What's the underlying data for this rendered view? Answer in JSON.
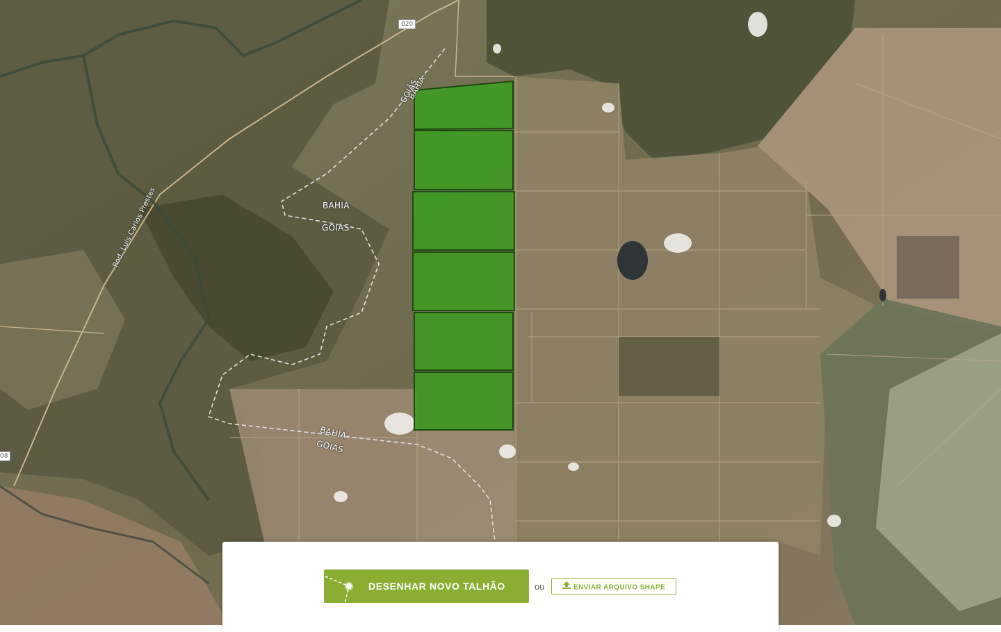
{
  "map": {
    "labels": {
      "bahia_top": "BAHIA",
      "goias_top": "GOIÁS",
      "bahia_mid": "BAHIA",
      "goias_mid": "GOIÁS",
      "bahia_bottom": "BAHIA",
      "goias_bottom": "GOIÁS",
      "road_name": "Rod. Luís Carlos Prestes"
    },
    "road_shields": {
      "top": "020",
      "left": "08"
    },
    "field_color": "#3f9a22",
    "field_border_color": "#1c4a10",
    "field_count": 6
  },
  "panel": {
    "draw_button": "DESENHAR NOVO TALHÃO",
    "or_text": "ou",
    "upload_button": "ENVIAR ARQUIVO SHAPE",
    "accent_color": "#89ae32"
  }
}
